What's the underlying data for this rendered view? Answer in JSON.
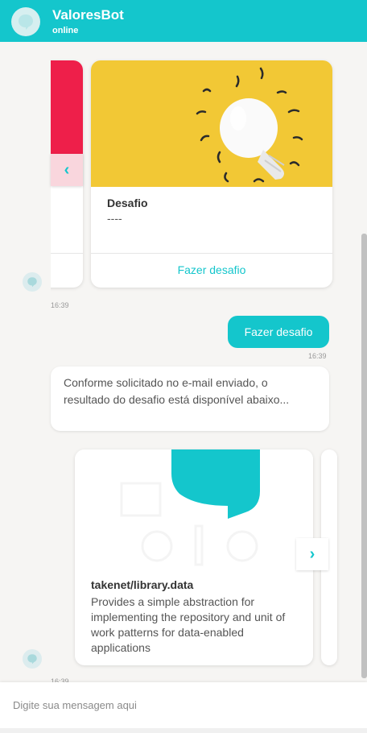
{
  "header": {
    "title": "ValoresBot",
    "status": "online"
  },
  "carousel1": {
    "card": {
      "title": "Desafio",
      "subtitle": "----",
      "action_label": "Fazer desafio",
      "image": "lightbulb-image"
    },
    "prev_icon": "chevron-left-icon",
    "time": "16:39"
  },
  "user_message": {
    "text": "Fazer desafio",
    "time": "16:39"
  },
  "bot_message": {
    "text": "Conforme solicitado no e-mail enviado, o resultado do desafio está disponível abaixo..."
  },
  "carousel2": {
    "card": {
      "title": "takenet/library.data",
      "description": "Provides a simple abstraction for implementing the repository and unit of work patterns for data-enabled applications",
      "image": "take-logo-image"
    },
    "next_icon": "chevron-right-icon",
    "time": "16:39"
  },
  "composer": {
    "placeholder": "Digite sua mensagem aqui"
  },
  "colors": {
    "accent": "#14c6cc",
    "card_red": "#ee1f4a",
    "card_yellow": "#f2c835"
  }
}
